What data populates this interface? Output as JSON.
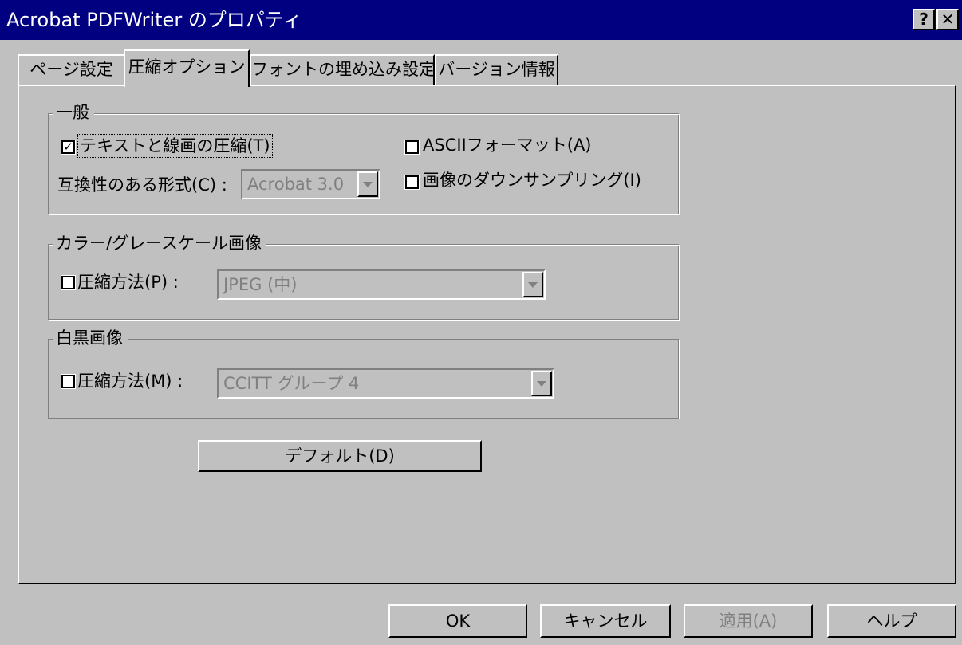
{
  "window": {
    "title": "Acrobat PDFWriter のプロパティ",
    "help_button": "?",
    "close_button": "✕"
  },
  "tabs": [
    {
      "label": "ページ設定"
    },
    {
      "label": "圧縮オプション"
    },
    {
      "label": "フォントの埋め込み設定"
    },
    {
      "label": "バージョン情報"
    }
  ],
  "general": {
    "legend": "一般",
    "compress_text": {
      "label": "テキストと線画の圧縮(T)",
      "checked": true
    },
    "ascii_format": {
      "label": "ASCIIフォーマット(A)",
      "checked": false
    },
    "compat_label": "互換性のある形式(C) :",
    "compat_value": "Acrobat 3.0",
    "downsample": {
      "label": "画像のダウンサンプリング(I)",
      "checked": false
    }
  },
  "color": {
    "legend": "カラー/グレースケール画像",
    "compress": {
      "label": "圧縮方法(P) :",
      "checked": false
    },
    "method_value": "JPEG (中)"
  },
  "mono": {
    "legend": "白黒画像",
    "compress": {
      "label": "圧縮方法(M) :",
      "checked": false
    },
    "method_value": "CCITT グループ 4"
  },
  "default_button": "デフォルト(D)",
  "footer": {
    "ok": "OK",
    "cancel": "キャンセル",
    "apply": "適用(A)",
    "help": "ヘルプ"
  },
  "colors": {
    "face": "#c0c0c0",
    "titlebar": "#000080",
    "disabled_text": "#808080"
  },
  "icons": {
    "checkbox_checked": "check-icon",
    "combo_arrow": "chevron-down-icon"
  }
}
